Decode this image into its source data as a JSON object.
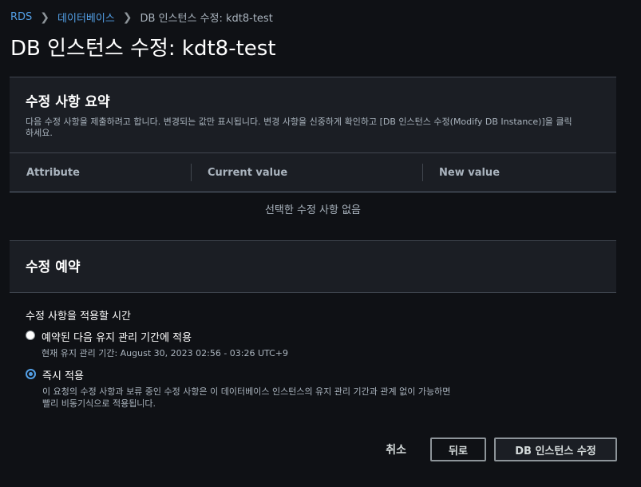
{
  "breadcrumb": {
    "items": [
      "RDS",
      "데이터베이스"
    ],
    "current": "DB 인스턴스 수정: kdt8-test"
  },
  "page": {
    "title": "DB 인스턴스 수정: kdt8-test"
  },
  "summary": {
    "title": "수정 사항 요약",
    "description": "다음 수정 사항을 제출하려고 합니다. 변경되는 값만 표시됩니다. 변경 사항을 신중하게 확인하고 [DB 인스턴스 수정(Modify DB Instance)]을 클릭하세요.",
    "columns": [
      "Attribute",
      "Current value",
      "New value"
    ],
    "empty_text": "선택한 수정 사항 없음"
  },
  "schedule": {
    "title": "수정 예약",
    "field_label": "수정 사항을 적용할 시간",
    "options": [
      {
        "label": "예약된 다음 유지 관리 기간에 적용",
        "description": "현재 유지 관리 기간: August 30, 2023 02:56 - 03:26 UTC+9",
        "checked": false
      },
      {
        "label": "즉시 적용",
        "description": "이 요청의 수정 사항과 보류 중인 수정 사항은 이 데이터베이스 인스턴스의 유지 관리 기간과 관계 없이 가능하면 빨리 비동기식으로 적용됩니다.",
        "checked": true
      }
    ]
  },
  "actions": {
    "cancel": "취소",
    "back": "뒤로",
    "submit": "DB 인스턴스 수정"
  },
  "colors": {
    "link": "#539fe5",
    "background": "#0f1115",
    "panel": "#16191f",
    "border": "#414750"
  }
}
